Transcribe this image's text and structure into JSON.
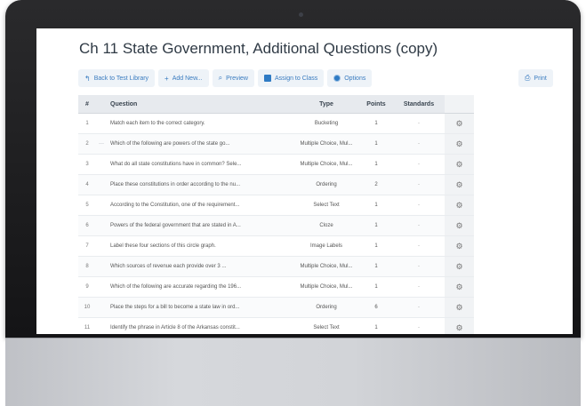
{
  "page": {
    "title": "Ch 11 State Government, Additional Questions (copy)"
  },
  "toolbar": {
    "back": {
      "label": "Back to Test Library",
      "icon": "back-arrow-icon"
    },
    "add_new": {
      "label": "Add New...",
      "icon": "plus-icon"
    },
    "preview": {
      "label": "Preview",
      "icon": "search-icon"
    },
    "assign": {
      "label": "Assign to Class",
      "icon": "assign-icon"
    },
    "options": {
      "label": "Options",
      "icon": "gear-icon"
    },
    "print": {
      "label": "Print",
      "icon": "print-icon"
    }
  },
  "table": {
    "headers": {
      "num": "#",
      "question": "Question",
      "type": "Type",
      "points": "Points",
      "standards": "Standards"
    },
    "rows": [
      {
        "num": "1",
        "marker": "",
        "question": "Match each item to the correct category.",
        "type": "Bucketing",
        "points": "1",
        "standards": "-"
      },
      {
        "num": "2",
        "marker": "—",
        "question": "Which of the following are powers of the state go...",
        "type": "Multiple Choice, Mul...",
        "points": "1",
        "standards": "-"
      },
      {
        "num": "3",
        "marker": "",
        "question": "What do all state constitutions have in common? Sele...",
        "type": "Multiple Choice, Mul...",
        "points": "1",
        "standards": "-"
      },
      {
        "num": "4",
        "marker": "",
        "question": "Place these constitutions in order according to the nu...",
        "type": "Ordering",
        "points": "2",
        "standards": "-"
      },
      {
        "num": "5",
        "marker": "",
        "question": "According to the Constitution, one of the requirement...",
        "type": "Select Text",
        "points": "1",
        "standards": "-"
      },
      {
        "num": "6",
        "marker": "",
        "question": "Powers of the federal government that are stated in A...",
        "type": "Cloze",
        "points": "1",
        "standards": "-"
      },
      {
        "num": "7",
        "marker": "",
        "question": "Label these four sections of this circle graph.",
        "type": "Image Labels",
        "points": "1",
        "standards": "-"
      },
      {
        "num": "8",
        "marker": "",
        "question": "Which sources of revenue each provide over 3 ...",
        "type": "Multiple Choice, Mul...",
        "points": "1",
        "standards": "-"
      },
      {
        "num": "9",
        "marker": "",
        "question": "Which of the following are accurate regarding the 196...",
        "type": "Multiple Choice, Mul...",
        "points": "1",
        "standards": "-"
      },
      {
        "num": "10",
        "marker": "",
        "question": "Place the steps for a bill to become a state law in ord...",
        "type": "Ordering",
        "points": "6",
        "standards": "-"
      },
      {
        "num": "11",
        "marker": "",
        "question": "Identify the phrase in Article 8 of the Arkansas constit...",
        "type": "Select Text",
        "points": "1",
        "standards": "-"
      }
    ]
  },
  "colors": {
    "accent": "#3a7cc0",
    "header_bg": "#e7eaee",
    "bezel": "#1e1e20"
  }
}
